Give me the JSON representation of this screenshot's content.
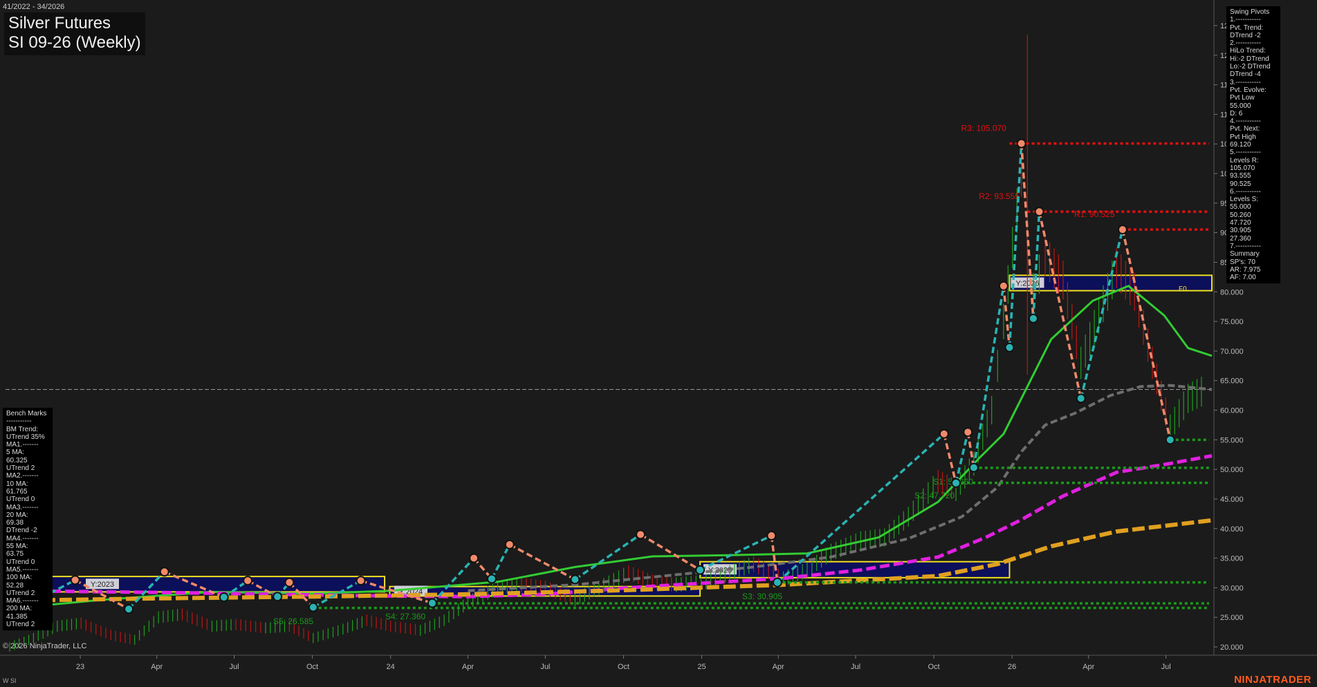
{
  "header": {
    "range": "41/2022 - 34/2026",
    "title_line1": "Silver Futures",
    "title_line2": "SI 09-26 (Weekly)"
  },
  "footer": {
    "copyright": "© 2026 NinjaTrader, LLC",
    "symbol_tag": "W SI",
    "brand": "NINJATRADER"
  },
  "swing_panel": {
    "lines": [
      "Swing Pivots",
      "1.-----------",
      "Pvt. Trend:",
      "DTrend -2",
      "2.-----------",
      "HiLo Trend:",
      "Hi:-2 DTrend",
      "Lo:-2 DTrend",
      "DTrend -4",
      "3.-----------",
      "Pvt. Evolve:",
      "Pvt Low",
      "55.000",
      "D: 6",
      "4.-----------",
      "Pvt. Next:",
      "Pvt High",
      "69.120",
      "5.-----------",
      "Levels R:",
      "105.070",
      "93.555",
      "90.525",
      "6.-----------",
      "Levels S:",
      "55.000",
      "50.260",
      "47.720",
      "30.905",
      "27.360",
      "7.-----------",
      "Summary",
      "SP's: 70",
      "AR: 7.975",
      "AF: 7.00"
    ]
  },
  "bench_panel": {
    "lines": [
      "Bench Marks",
      "-----------",
      "BM Trend:",
      "UTrend 35%",
      "MA1.-------",
      "5 MA:",
      "60.325",
      "UTrend 2",
      "MA2.-------",
      "10 MA:",
      "61.765",
      "UTrend 0",
      "MA3.-------",
      "20 MA:",
      "69.38",
      "DTrend -2",
      "MA4.-------",
      "55 MA:",
      "63.75",
      "UTrend 0",
      "MA5.-------",
      "100 MA:",
      "52.28",
      "UTrend 2",
      "MA6.-------",
      "200 MA:",
      "41.385",
      "UTrend 2"
    ]
  },
  "colors": {
    "background": "#1b1b1b",
    "resistance": "#e01010",
    "support": "#1a9a1a",
    "pivot_up": "#2ab3b3",
    "pivot_down": "#f08a6a",
    "ma_green": "#33cc33",
    "ma_grey": "#777777",
    "ma_magenta": "#e020e0",
    "ma_orange": "#e0a020",
    "year_box": "#f0e020"
  },
  "chart_data": {
    "type": "candlestick",
    "title": "SI 09-26 (Weekly)",
    "y_axis": {
      "min": 20,
      "max": 125,
      "side": "right",
      "ticks": [
        125,
        120,
        115,
        110,
        105,
        100,
        95,
        90,
        85,
        80,
        75,
        70,
        65,
        60,
        55,
        50,
        45,
        40,
        35,
        30,
        25,
        20
      ],
      "tick_labels": [
        "125.000",
        "120.000",
        "115.000",
        "110.000",
        "105.000",
        "100.000",
        "95.000",
        "90.000",
        "85.000",
        "80.000",
        "75.000",
        "70.000",
        "65.000",
        "60.000",
        "55.000",
        "50.000",
        "45.000",
        "40.000",
        "35.000",
        "30.000",
        "25.000",
        "20.000"
      ]
    },
    "x_axis": {
      "start": "2022-10-10",
      "end": "2026-08-24",
      "ticks": [
        {
          "label": "23",
          "date": "2023-01-01"
        },
        {
          "label": "Apr",
          "date": "2023-04-01"
        },
        {
          "label": "Jul",
          "date": "2023-07-01"
        },
        {
          "label": "Oct",
          "date": "2023-10-01"
        },
        {
          "label": "24",
          "date": "2024-01-01"
        },
        {
          "label": "Apr",
          "date": "2024-04-01"
        },
        {
          "label": "Jul",
          "date": "2024-07-01"
        },
        {
          "label": "Oct",
          "date": "2024-10-01"
        },
        {
          "label": "25",
          "date": "2025-01-01"
        },
        {
          "label": "Apr",
          "date": "2025-04-01"
        },
        {
          "label": "Jul",
          "date": "2025-07-01"
        },
        {
          "label": "Oct",
          "date": "2025-10-01"
        },
        {
          "label": "26",
          "date": "2026-01-01"
        },
        {
          "label": "Apr",
          "date": "2026-04-01"
        },
        {
          "label": "Jul",
          "date": "2026-07-01"
        }
      ]
    },
    "current_price": 63.5,
    "resistance_levels": [
      {
        "label": "R3: 105.070",
        "value": 105.07,
        "from": "2025-12-29"
      },
      {
        "label": "R2: 93.555",
        "value": 93.555,
        "from": "2026-01-19"
      },
      {
        "label": "R1: 90.525",
        "value": 90.525,
        "from": "2026-05-11"
      }
    ],
    "support_levels": [
      {
        "label": "",
        "value": 55.0,
        "from": "2026-07-06"
      },
      {
        "label": "S1: 50.260",
        "value": 50.26,
        "from": "2025-11-17"
      },
      {
        "label": "S2: 47.720",
        "value": 47.72,
        "from": "2025-10-27"
      },
      {
        "label": "S3: 30.905",
        "value": 30.905,
        "from": "2025-03-31"
      },
      {
        "label": "S4: 27.360",
        "value": 27.36,
        "from": "2024-02-19"
      },
      {
        "label": "S5: 26.585",
        "value": 26.585,
        "from": "2023-10-02"
      }
    ],
    "pivots": [
      {
        "date": "2022-10-17",
        "value": 26.0,
        "type": "low"
      },
      {
        "date": "2022-12-26",
        "value": 31.3,
        "type": "high"
      },
      {
        "date": "2023-02-27",
        "value": 26.4,
        "type": "low"
      },
      {
        "date": "2023-04-10",
        "value": 26.4,
        "type": "high_skip"
      },
      {
        "date": "2023-04-10",
        "value": 32.7,
        "type": "high"
      },
      {
        "date": "2023-06-19",
        "value": 28.4,
        "type": "low"
      },
      {
        "date": "2023-07-17",
        "value": 31.2,
        "type": "high"
      },
      {
        "date": "2023-08-21",
        "value": 28.5,
        "type": "low"
      },
      {
        "date": "2023-09-04",
        "value": 30.9,
        "type": "high"
      },
      {
        "date": "2023-10-02",
        "value": 26.7,
        "type": "low"
      },
      {
        "date": "2023-11-27",
        "value": 31.2,
        "type": "high"
      },
      {
        "date": "2024-02-19",
        "value": 27.4,
        "type": "low"
      },
      {
        "date": "2024-04-08",
        "value": 35.0,
        "type": "high"
      },
      {
        "date": "2024-04-29",
        "value": 31.5,
        "type": "low"
      },
      {
        "date": "2024-05-20",
        "value": 37.3,
        "type": "high"
      },
      {
        "date": "2024-08-05",
        "value": 31.4,
        "type": "low"
      },
      {
        "date": "2024-10-21",
        "value": 39.0,
        "type": "high"
      },
      {
        "date": "2024-12-30",
        "value": 33.0,
        "type": "low"
      },
      {
        "date": "2025-03-24",
        "value": 38.8,
        "type": "high"
      },
      {
        "date": "2025-03-31",
        "value": 30.9,
        "type": "low"
      },
      {
        "date": "2025-10-13",
        "value": 56.0,
        "type": "high"
      },
      {
        "date": "2025-10-27",
        "value": 47.7,
        "type": "low"
      },
      {
        "date": "2025-11-10",
        "value": 56.3,
        "type": "high"
      },
      {
        "date": "2025-11-17",
        "value": 50.3,
        "type": "low"
      },
      {
        "date": "2025-12-22",
        "value": 81.0,
        "type": "high"
      },
      {
        "date": "2025-12-29",
        "value": 70.6,
        "type": "low"
      },
      {
        "date": "2026-01-12",
        "value": 105.07,
        "type": "high"
      },
      {
        "date": "2026-01-26",
        "value": 75.5,
        "type": "low"
      },
      {
        "date": "2026-02-02",
        "value": 93.555,
        "type": "high"
      },
      {
        "date": "2026-03-23",
        "value": 62.0,
        "type": "low"
      },
      {
        "date": "2026-05-11",
        "value": 90.525,
        "type": "high"
      },
      {
        "date": "2026-07-06",
        "value": 55.0,
        "type": "low"
      }
    ],
    "year_boxes": [
      {
        "label": "Y:2023",
        "from": "2022-10-10",
        "to": "2023-12-25",
        "high": 31.9,
        "low": 29.3
      },
      {
        "label": "Y:2024",
        "from": "2023-12-31",
        "to": "2024-12-30",
        "high": 30.2,
        "low": 28.6
      },
      {
        "label": "Y:2025",
        "from": "2024-12-30",
        "to": "2025-12-29",
        "high": 34.4,
        "low": 31.7
      },
      {
        "label": "Y:2026",
        "from": "2025-12-29",
        "to": "2026-08-24",
        "high": 82.8,
        "low": 80.2
      }
    ],
    "year_box_tag": "F0",
    "moving_averages": [
      {
        "name": "20 MA",
        "color": "#33cc33",
        "points": [
          [
            "2022-10-10",
            26.5
          ],
          [
            "2023-01-30",
            28.0
          ],
          [
            "2023-06-05",
            29.3
          ],
          [
            "2023-10-02",
            29.0
          ],
          [
            "2024-01-01",
            29.5
          ],
          [
            "2024-05-06",
            31.0
          ],
          [
            "2024-08-05",
            33.5
          ],
          [
            "2024-11-04",
            35.3
          ],
          [
            "2025-02-03",
            35.5
          ],
          [
            "2025-05-05",
            35.8
          ],
          [
            "2025-07-28",
            38.5
          ],
          [
            "2025-10-06",
            44.5
          ],
          [
            "2025-11-24",
            52.0
          ],
          [
            "2025-12-22",
            56.0
          ],
          [
            "2026-01-19",
            64.0
          ],
          [
            "2026-02-16",
            72.0
          ],
          [
            "2026-04-06",
            78.5
          ],
          [
            "2026-05-18",
            81.0
          ],
          [
            "2026-06-29",
            76.0
          ],
          [
            "2026-07-27",
            70.5
          ],
          [
            "2026-08-24",
            69.2
          ]
        ]
      },
      {
        "name": "55 MA",
        "color": "#6e6e6e",
        "points": [
          [
            "2024-04-01",
            29.5
          ],
          [
            "2024-08-05",
            30.5
          ],
          [
            "2024-12-02",
            32.2
          ],
          [
            "2025-03-03",
            33.5
          ],
          [
            "2025-06-02",
            35.2
          ],
          [
            "2025-09-01",
            38.3
          ],
          [
            "2025-11-03",
            42.0
          ],
          [
            "2025-12-15",
            47.0
          ],
          [
            "2026-01-12",
            53.0
          ],
          [
            "2026-02-09",
            57.5
          ],
          [
            "2026-03-16",
            59.5
          ],
          [
            "2026-04-27",
            62.5
          ],
          [
            "2026-06-01",
            64.0
          ],
          [
            "2026-07-06",
            64.2
          ],
          [
            "2026-08-24",
            63.5
          ]
        ]
      },
      {
        "name": "100 MA",
        "color": "#e020e0",
        "points": [
          [
            "2022-10-10",
            29.5
          ],
          [
            "2023-04-03",
            29.2
          ],
          [
            "2023-10-02",
            28.8
          ],
          [
            "2024-01-01",
            28.6
          ],
          [
            "2024-04-01",
            28.5
          ],
          [
            "2024-07-01",
            28.9
          ],
          [
            "2024-10-07",
            30.0
          ],
          [
            "2025-01-06",
            30.8
          ],
          [
            "2025-04-07",
            31.6
          ],
          [
            "2025-07-07",
            33.0
          ],
          [
            "2025-10-06",
            35.2
          ],
          [
            "2025-12-01",
            38.5
          ],
          [
            "2026-01-12",
            41.5
          ],
          [
            "2026-03-02",
            45.5
          ],
          [
            "2026-05-04",
            49.5
          ],
          [
            "2026-07-06",
            51.0
          ],
          [
            "2026-08-24",
            52.3
          ]
        ]
      },
      {
        "name": "200 MA",
        "color": "#e0a020",
        "points": [
          [
            "2022-10-10",
            27.8
          ],
          [
            "2023-04-03",
            28.2
          ],
          [
            "2023-10-02",
            28.5
          ],
          [
            "2024-04-01",
            28.9
          ],
          [
            "2024-10-07",
            29.6
          ],
          [
            "2025-04-07",
            30.5
          ],
          [
            "2025-10-06",
            32.0
          ],
          [
            "2025-12-15",
            34.0
          ],
          [
            "2026-02-16",
            37.0
          ],
          [
            "2026-05-04",
            39.5
          ],
          [
            "2026-08-24",
            41.4
          ]
        ]
      }
    ],
    "price_series": [
      [
        "2022-10-10",
        20.0
      ],
      [
        "2022-11-07",
        21.5
      ],
      [
        "2022-12-05",
        23.5
      ],
      [
        "2023-01-02",
        24.0
      ],
      [
        "2023-02-06",
        22.0
      ],
      [
        "2023-03-06",
        21.2
      ],
      [
        "2023-04-03",
        25.0
      ],
      [
        "2023-05-01",
        25.5
      ],
      [
        "2023-06-05",
        23.5
      ],
      [
        "2023-07-03",
        23.8
      ],
      [
        "2023-08-07",
        23.2
      ],
      [
        "2023-09-04",
        23.5
      ],
      [
        "2023-10-02",
        21.5
      ],
      [
        "2023-11-06",
        23.0
      ],
      [
        "2023-12-04",
        24.5
      ],
      [
        "2024-01-01",
        23.5
      ],
      [
        "2024-02-05",
        22.8
      ],
      [
        "2024-03-04",
        24.5
      ],
      [
        "2024-04-01",
        27.5
      ],
      [
        "2024-05-06",
        30.0
      ],
      [
        "2024-06-03",
        30.5
      ],
      [
        "2024-07-01",
        30.0
      ],
      [
        "2024-08-05",
        28.0
      ],
      [
        "2024-09-02",
        30.0
      ],
      [
        "2024-10-07",
        32.5
      ],
      [
        "2024-11-04",
        31.0
      ],
      [
        "2024-12-02",
        30.5
      ],
      [
        "2025-01-06",
        31.0
      ],
      [
        "2025-02-03",
        32.5
      ],
      [
        "2025-03-03",
        34.0
      ],
      [
        "2025-04-07",
        31.5
      ],
      [
        "2025-05-05",
        33.0
      ],
      [
        "2025-06-02",
        36.0
      ],
      [
        "2025-07-07",
        38.0
      ],
      [
        "2025-08-04",
        38.5
      ],
      [
        "2025-09-01",
        42.0
      ],
      [
        "2025-10-06",
        48.0
      ],
      [
        "2025-10-27",
        46.5
      ],
      [
        "2025-11-17",
        51.0
      ],
      [
        "2025-12-08",
        60.0
      ],
      [
        "2025-12-22",
        75.0
      ],
      [
        "2026-01-12",
        100.0
      ],
      [
        "2026-01-26",
        80.0
      ],
      [
        "2026-02-09",
        86.0
      ],
      [
        "2026-03-02",
        82.0
      ],
      [
        "2026-03-23",
        68.0
      ],
      [
        "2026-04-13",
        76.0
      ],
      [
        "2026-05-04",
        84.0
      ],
      [
        "2026-05-25",
        80.0
      ],
      [
        "2026-06-15",
        68.0
      ],
      [
        "2026-07-06",
        57.0
      ],
      [
        "2026-07-27",
        62.0
      ],
      [
        "2026-08-17",
        63.5
      ]
    ]
  }
}
